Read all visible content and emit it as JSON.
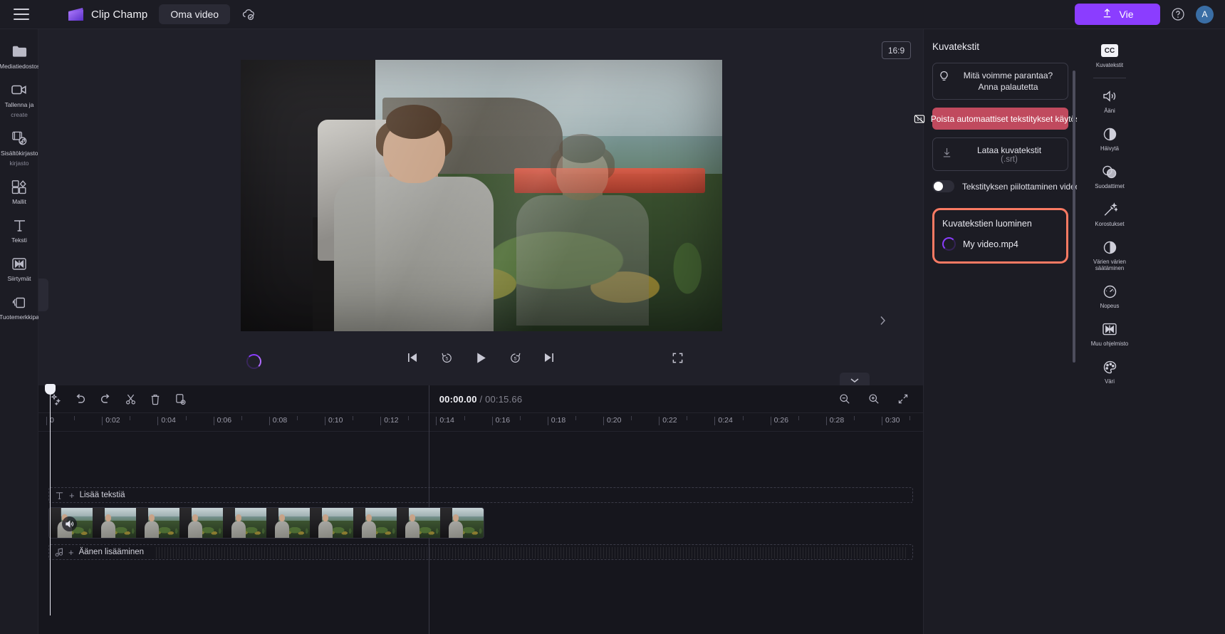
{
  "app": {
    "brand": "Clip Champ",
    "project_name": "Oma video"
  },
  "topbar": {
    "menu_icon": "hamburger-icon",
    "logo_icon": "clipchamp-logo-icon",
    "cloud_save_icon": "cloud-saved-icon",
    "export_label": "Vie",
    "export_icon": "upload-icon",
    "export_color": "#8b3dff",
    "help_icon": "help-circle-icon",
    "avatar_initial": "A"
  },
  "sidebar": {
    "items": [
      {
        "label": "Mediatiedostosi",
        "sublabel": "",
        "icon": "folder-icon"
      },
      {
        "label": "Tallenna ja",
        "sublabel": "create",
        "icon": "video-camera-icon"
      },
      {
        "label": "Sisältökirjaston",
        "sublabel": "kirjasto",
        "icon": "content-library-icon"
      },
      {
        "label": "Mallit",
        "sublabel": "",
        "icon": "templates-icon"
      },
      {
        "label": "Teksti",
        "sublabel": "",
        "icon": "text-icon"
      },
      {
        "label": "Siirtymät",
        "sublabel": "",
        "icon": "transitions-icon"
      },
      {
        "label": "Tuotemerkkipaketti",
        "sublabel": "",
        "icon": "brand-kit-icon"
      }
    ]
  },
  "stage": {
    "aspect_ratio": "16:9",
    "loading_spinner": "loading-spinner",
    "collapse_icon": "chevron-right-icon",
    "chevron_down_icon": "chevron-down-icon",
    "controls": [
      {
        "name": "skip-to-start-button",
        "icon": "skip-previous-icon"
      },
      {
        "name": "rewind-5-button",
        "icon": "rewind-5-icon"
      },
      {
        "name": "play-button",
        "icon": "play-icon"
      },
      {
        "name": "forward-5-button",
        "icon": "forward-5-icon"
      },
      {
        "name": "skip-to-end-button",
        "icon": "skip-next-icon"
      }
    ],
    "fullscreen_icon": "fullscreen-icon"
  },
  "timeline": {
    "toolbar_left": [
      {
        "name": "magic-tools-button",
        "icon": "sparkle-icon"
      },
      {
        "name": "undo-button",
        "icon": "undo-icon"
      },
      {
        "name": "redo-button",
        "icon": "redo-icon"
      },
      {
        "name": "split-button",
        "icon": "scissors-icon"
      },
      {
        "name": "delete-button",
        "icon": "trash-icon"
      },
      {
        "name": "duplicate-button",
        "icon": "duplicate-icon"
      }
    ],
    "current_time": "00:00.00",
    "total_time": "/ 00:15.66",
    "toolbar_right": [
      {
        "name": "zoom-out-button",
        "icon": "zoom-out-icon"
      },
      {
        "name": "zoom-in-button",
        "icon": "zoom-in-icon"
      },
      {
        "name": "fit-timeline-button",
        "icon": "fit-icon"
      }
    ],
    "ruler_ticks": [
      "0",
      "0:02",
      "0:04",
      "0:06",
      "0:08",
      "0:10",
      "0:12",
      "0:14",
      "0:16",
      "0:18",
      "0:20",
      "0:22",
      "0:24",
      "0:26",
      "0:28",
      "0:30"
    ],
    "text_track": {
      "label": "Lisää tekstiä",
      "icon": "text-track-icon",
      "plus": "+"
    },
    "audio_track": {
      "label": "Äänen lisääminen",
      "icon": "music-note-icon",
      "plus": "+"
    },
    "video_clip": {
      "name": "My video.mp4",
      "mute_icon": "speaker-icon"
    }
  },
  "captions_panel": {
    "title": "Kuvatekstit",
    "feedback": {
      "icon": "lightbulb-icon",
      "line1": "Mitä voimme parantaa?",
      "line2": "Anna palautetta"
    },
    "disable_button": {
      "label": "Poista automaattiset tekstitykset käytöstä",
      "icon": "captions-off-icon",
      "color": "#c04a5e"
    },
    "download_button": {
      "icon": "download-icon",
      "line1": "Lataa kuvatekstit",
      "line2": "(.srt)"
    },
    "toggle": {
      "label": "Tekstityksen piilottaminen videossa",
      "state": "off"
    },
    "generating": {
      "title": "Kuvatekstien luominen",
      "file": "My video.mp4",
      "spinner": "loading-spinner",
      "highlight_color": "#fa7a63"
    }
  },
  "right_rail": {
    "items": [
      {
        "label": "Kuvatekstit",
        "icon": "cc-icon",
        "badge": "CC"
      },
      {
        "label": "Ääni",
        "icon": "volume-icon"
      },
      {
        "label": "Häivytä",
        "icon": "fade-icon"
      },
      {
        "label": "Suodattimet",
        "icon": "filters-icon"
      },
      {
        "label": "Korostukset",
        "icon": "magic-wand-icon"
      },
      {
        "label": "Värien värien säätäminen",
        "icon": "contrast-icon"
      },
      {
        "label": "Nopeus",
        "icon": "speed-icon"
      },
      {
        "label": "Muu ohjelmisto",
        "icon": "transition-icon"
      },
      {
        "label": "Väri",
        "icon": "palette-icon"
      }
    ]
  }
}
